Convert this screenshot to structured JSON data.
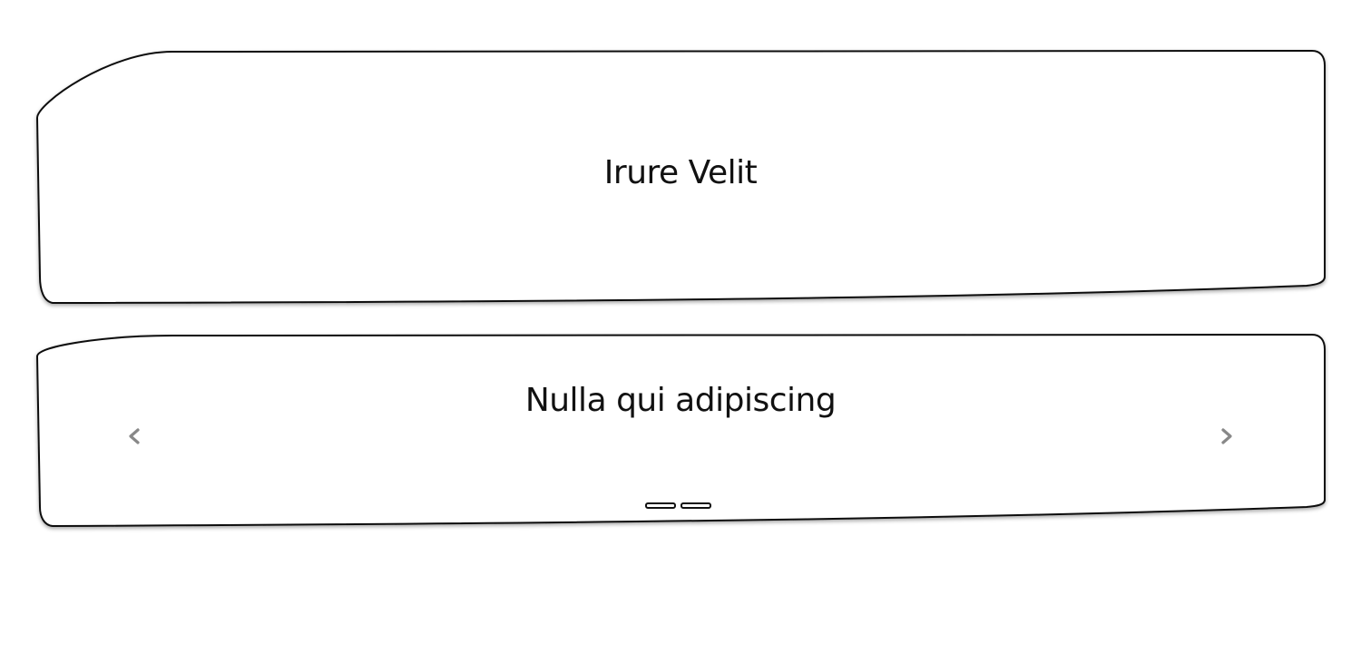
{
  "banner": {
    "title": "Irure Velit"
  },
  "carousel": {
    "slide_title": "Nulla qui adipiscing",
    "prev_icon": "chevron-left-icon",
    "next_icon": "chevron-right-icon",
    "indicator_count": 2,
    "active_indicator": 0
  },
  "colors": {
    "stroke": "#111111",
    "arrow": "#888888",
    "background": "#ffffff"
  }
}
